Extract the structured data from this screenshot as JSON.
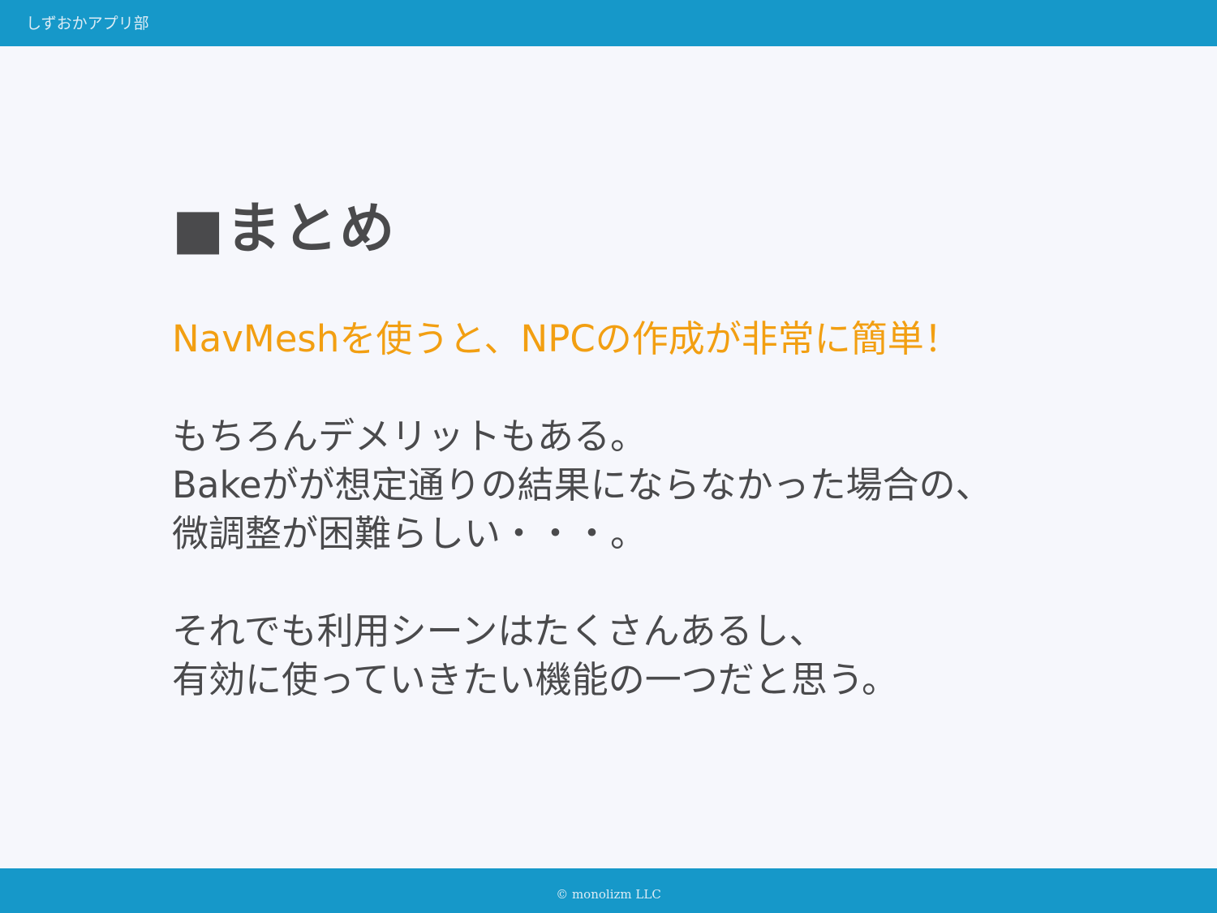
{
  "header": {
    "title": "しずおかアプリ部"
  },
  "slide": {
    "heading": "■まとめ",
    "highlight": "NavMeshを使うと、NPCの作成が非常に簡単！",
    "paragraphs": [
      {
        "lines": [
          "もちろんデメリットもある。",
          "Bakeがが想定通りの結果にならなかった場合の、",
          "微調整が困難らしい・・・。"
        ]
      },
      {
        "lines": [
          "それでも利用シーンはたくさんあるし、",
          "有効に使っていきたい機能の一つだと思う。"
        ]
      }
    ]
  },
  "footer": {
    "copyright": "© monolizm LLC"
  },
  "colors": {
    "bar": "#1698c9",
    "background": "#f6f7fc",
    "text": "#4a4a4c",
    "highlight": "#f29f12"
  }
}
